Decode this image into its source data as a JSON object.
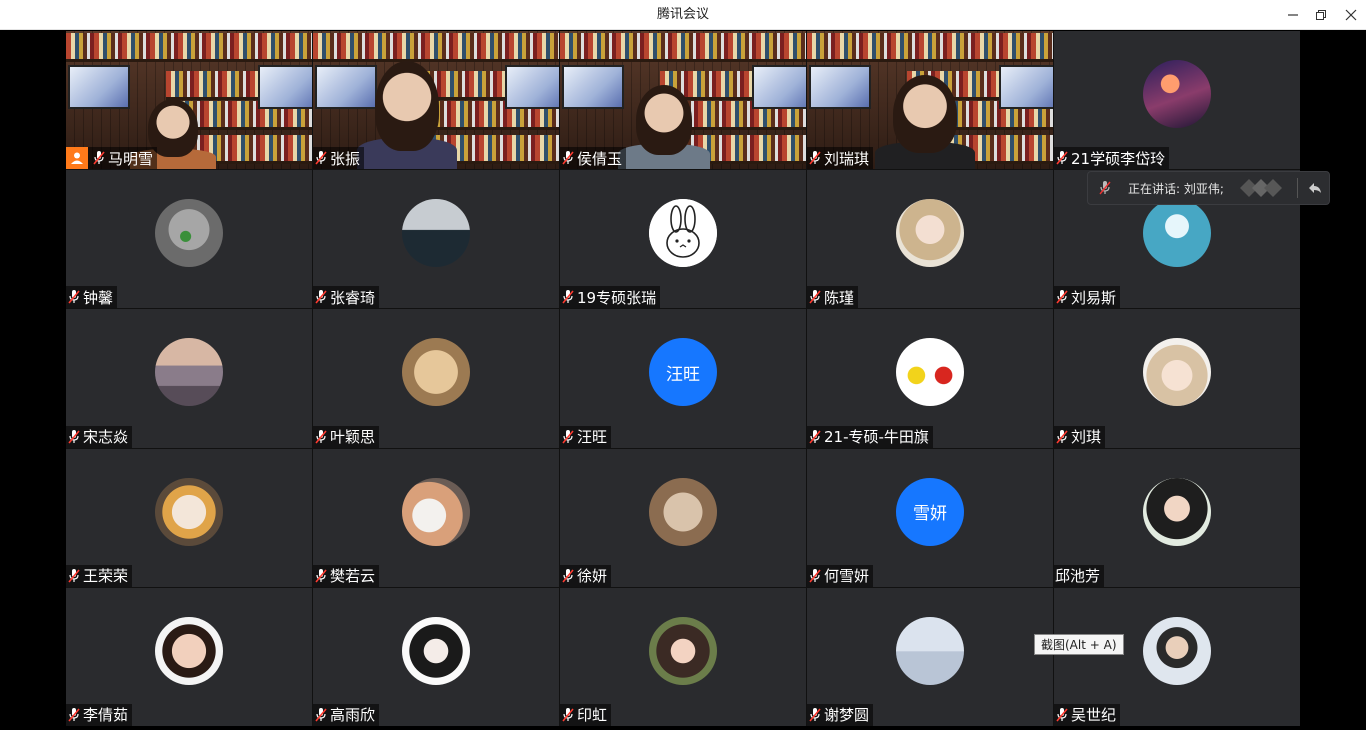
{
  "window": {
    "title": "腾讯会议"
  },
  "speaking_bar": {
    "label": "正在讲话: 刘亚伟;"
  },
  "tooltip": {
    "text": "截图(Alt + A)"
  },
  "participants": [
    {
      "name": "马明雪",
      "type": "video",
      "host": true,
      "mic": true
    },
    {
      "name": "张振",
      "type": "video",
      "mic": true
    },
    {
      "name": "侯倩玉",
      "type": "video",
      "mic": true
    },
    {
      "name": "刘瑞琪",
      "type": "video",
      "mic": true
    },
    {
      "name": "21学硕李岱玲",
      "type": "avatar",
      "icon": "city-night-avatar",
      "mic": true
    },
    {
      "name": "钟馨",
      "type": "avatar",
      "icon": "koala-avatar",
      "mic": true
    },
    {
      "name": "张睿琦",
      "type": "avatar",
      "icon": "seaside-avatar",
      "mic": true
    },
    {
      "name": "19专硕张瑞",
      "type": "avatar",
      "icon": "rabbit-avatar",
      "mic": true
    },
    {
      "name": "陈瑾",
      "type": "avatar",
      "icon": "illustrated-girl-avatar",
      "mic": true
    },
    {
      "name": "刘易斯",
      "type": "avatar",
      "icon": "polar-bear-avatar",
      "mic": true
    },
    {
      "name": "宋志焱",
      "type": "avatar",
      "icon": "sunset-girl-avatar",
      "mic": true
    },
    {
      "name": "叶颖思",
      "type": "avatar",
      "icon": "cat-avatar",
      "mic": true
    },
    {
      "name": "汪旺",
      "type": "text",
      "initials": "汪旺",
      "mic": true
    },
    {
      "name": "21-专硕-牛田旗",
      "type": "avatar",
      "icon": "cartoon-figures-avatar",
      "mic": true
    },
    {
      "name": "刘琪",
      "type": "avatar",
      "icon": "anime-girl-avatar",
      "mic": true
    },
    {
      "name": "王荣荣",
      "type": "avatar",
      "icon": "plush-toy-avatar",
      "mic": true
    },
    {
      "name": "樊若云",
      "type": "avatar",
      "icon": "girl-with-dog-avatar",
      "mic": true
    },
    {
      "name": "徐妍",
      "type": "avatar",
      "icon": "kitten-avatar",
      "mic": true
    },
    {
      "name": "何雪妍",
      "type": "text",
      "initials": "雪妍",
      "mic": true
    },
    {
      "name": "邱池芳",
      "type": "avatar",
      "icon": "little-girl-avatar",
      "mic": false
    },
    {
      "name": "李倩茹",
      "type": "avatar",
      "icon": "baby-avatar",
      "mic": true
    },
    {
      "name": "高雨欣",
      "type": "avatar",
      "icon": "sketch-girl-avatar",
      "mic": true
    },
    {
      "name": "印虹",
      "type": "avatar",
      "icon": "flower-girl-avatar",
      "mic": true
    },
    {
      "name": "谢梦圆",
      "type": "avatar",
      "icon": "winter-girl-avatar",
      "mic": true
    },
    {
      "name": "吴世纪",
      "type": "avatar",
      "icon": "young-man-avatar",
      "mic": true
    }
  ]
}
